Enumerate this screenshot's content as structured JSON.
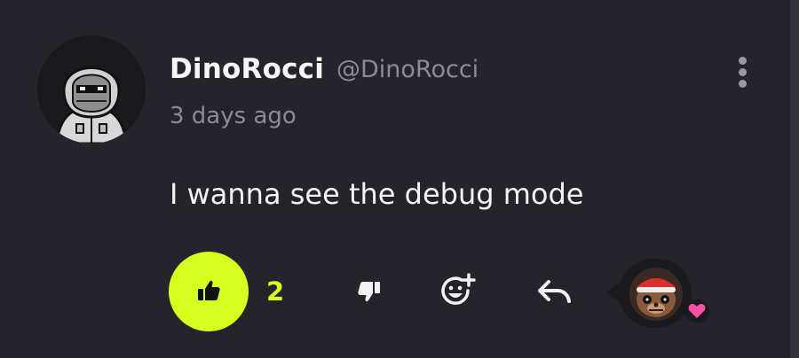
{
  "comment": {
    "author": {
      "display_name": "DinoRocci",
      "handle": "@DinoRocci",
      "avatar": "hooded-character-avatar"
    },
    "timestamp": "3 days ago",
    "text": "I wanna see the debug mode",
    "actions": {
      "like_count": "2",
      "like_icon": "thumbs-up-icon",
      "dislike_icon": "thumbs-down-icon",
      "emoji_icon": "add-emoji-icon",
      "reply_icon": "reply-arrow-icon",
      "more_icon": "more-vertical-icon"
    },
    "creator_reaction": {
      "avatar": "creator-avatar",
      "badge": "heart-icon",
      "heart_color": "#ff4fa3"
    }
  },
  "colors": {
    "background": "#25232b",
    "accent": "#d6ff1f",
    "muted_text": "#8d8a96",
    "text": "#f4f4f4"
  }
}
